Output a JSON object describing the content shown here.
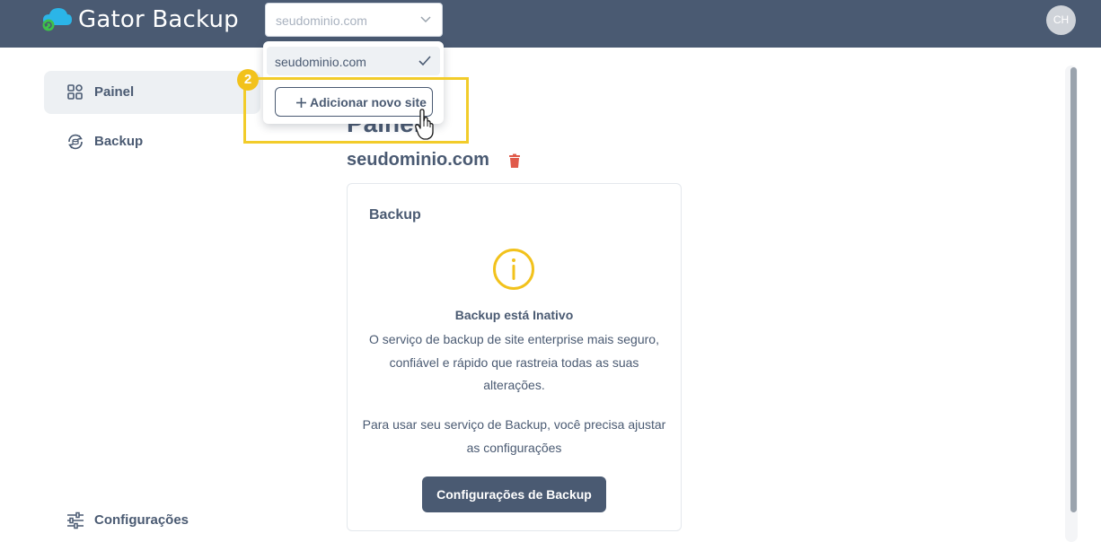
{
  "header": {
    "app_title": "Gator Backup",
    "site_select_value": "seudominio.com",
    "avatar_initials": "CH",
    "logo_icon": "cloud-sync-icon",
    "bar_color": "#4a5a72"
  },
  "sidebar": {
    "items": [
      {
        "label": "Painel",
        "icon": "dashboard-grid-icon",
        "active": true
      },
      {
        "label": "Backup",
        "icon": "backup-cycle-icon",
        "active": false
      },
      {
        "label": "Configurações",
        "icon": "sliders-icon",
        "active": false
      }
    ]
  },
  "main": {
    "page_title": "Painel",
    "site_name": "seudominio.com",
    "delete_icon": "trash-icon",
    "backup_card": {
      "title": "Backup",
      "status_icon": "info-circle-icon",
      "status_title": "Backup está Inativo",
      "description": "O serviço de backup de site enterprise mais seguro, confiável e rápido que rastreia todas as suas alterações.",
      "hint": "Para usar seu serviço de Backup, você precisa ajustar as configurações",
      "button_label": "Configurações de Backup"
    }
  },
  "dropdown": {
    "options": [
      {
        "label": "seudominio.com",
        "selected": true
      }
    ],
    "add_button_label": "Adicionar novo site"
  },
  "annotation": {
    "step_number": "2",
    "highlight_color": "#f2cc2a"
  },
  "colors": {
    "primary": "#4a5a72",
    "warning": "#f2c21c",
    "danger": "#e05a4a",
    "logo_blue": "#2bb5e8",
    "logo_green": "#3ec14a"
  }
}
